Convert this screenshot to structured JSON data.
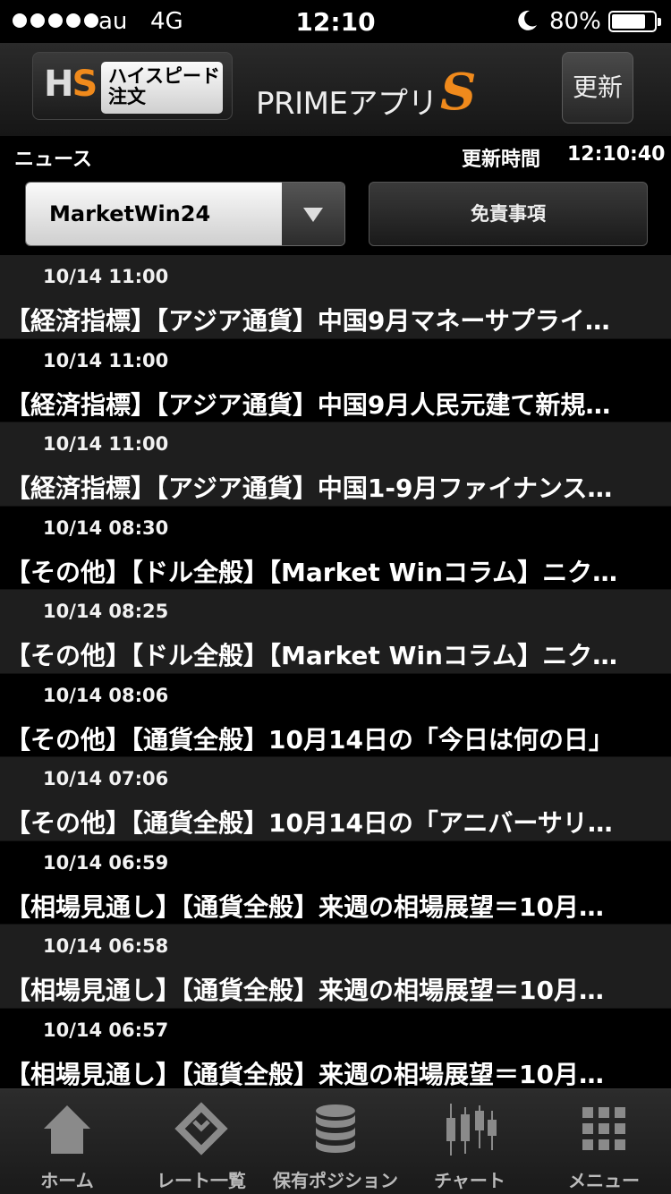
{
  "status_bar": {
    "carrier": "au",
    "network": "4G",
    "time": "12:10",
    "battery_text": "80%",
    "battery_level": 0.8
  },
  "header": {
    "hs_logo_h": "H",
    "hs_logo_s": "S",
    "hs_label_line1": "ハイスピード",
    "hs_label_line2": "注文",
    "app_title": "PRIMEアプリ",
    "app_title_s": "S",
    "update_button": "更新",
    "accent_color": "#f08a1c"
  },
  "subheader": {
    "section_title": "ニュース",
    "update_label": "更新時間",
    "update_time": "12:10:40",
    "source_selected": "MarketWin24",
    "disclaimer_button": "免責事項"
  },
  "news": [
    {
      "date": "10/14 11:00",
      "title": "【経済指標】【アジア通貨】中国9月マネーサプライ…"
    },
    {
      "date": "10/14 11:00",
      "title": "【経済指標】【アジア通貨】中国9月人民元建て新規…"
    },
    {
      "date": "10/14 11:00",
      "title": "【経済指標】【アジア通貨】中国1-9月ファイナンス…"
    },
    {
      "date": "10/14 08:30",
      "title": "【その他】【ドル全般】【Market Winコラム】ニク…"
    },
    {
      "date": "10/14 08:25",
      "title": "【その他】【ドル全般】【Market Winコラム】ニク…"
    },
    {
      "date": "10/14 08:06",
      "title": "【その他】【通貨全般】10月14日の「今日は何の日」"
    },
    {
      "date": "10/14 07:06",
      "title": "【その他】【通貨全般】10月14日の「アニバーサリ…"
    },
    {
      "date": "10/14 06:59",
      "title": "【相場見通し】【通貨全般】来週の相場展望＝10月…"
    },
    {
      "date": "10/14 06:58",
      "title": "【相場見通し】【通貨全般】来週の相場展望＝10月…"
    },
    {
      "date": "10/14 06:57",
      "title": "【相場見通し】【通貨全般】来週の相場展望＝10月…"
    }
  ],
  "tabbar": {
    "home": {
      "label": "ホーム",
      "icon": "home-icon"
    },
    "rates": {
      "label": "レート一覧",
      "icon": "rates-icon"
    },
    "positions": {
      "label": "保有ポジション",
      "icon": "coins-stack-icon"
    },
    "chart": {
      "label": "チャート",
      "icon": "candlestick-chart-icon"
    },
    "menu": {
      "label": "メニュー",
      "icon": "grid-menu-icon"
    }
  }
}
